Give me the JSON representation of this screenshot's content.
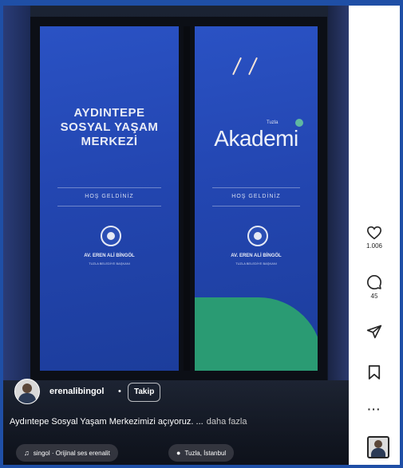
{
  "post": {
    "username": "erenalibingol",
    "separator": "•",
    "follow_label": "Takip",
    "caption": "Aydıntepe Sosyal Yaşam Merkezimizi açıyoruz. ...",
    "more_label": "daha fazla",
    "audio_label": "singol · Orijinal ses  erenalit",
    "audio_icon": "♫",
    "location_label": "Tuzla, İstanbul",
    "location_icon": "●"
  },
  "actions": {
    "like_count": "1.006",
    "comment_count": "45",
    "more_label": "···"
  },
  "video_signage": {
    "left_title": "AYDINTEPE\nSOSYAL YAŞAM\nMERKEZİ",
    "welcome": "HOŞ GELDİNİZ",
    "welcome_right": "HOŞ GELDİNİZ",
    "name": "AV. EREN ALİ BİNGÖL",
    "name_right": "AV. EREN ALİ BİNGÖL",
    "sub": "TUZLA BELEDİYE BAŞKANI",
    "sub_right": "TUZLA BELEDİYE BAŞKANI",
    "akademi": "Akademi",
    "akademi_prefix": "Tuzla"
  },
  "colors": {
    "page_background": "#1f4fa6",
    "sign_blue": "#2346b1",
    "sign_green": "#2a9b73"
  }
}
